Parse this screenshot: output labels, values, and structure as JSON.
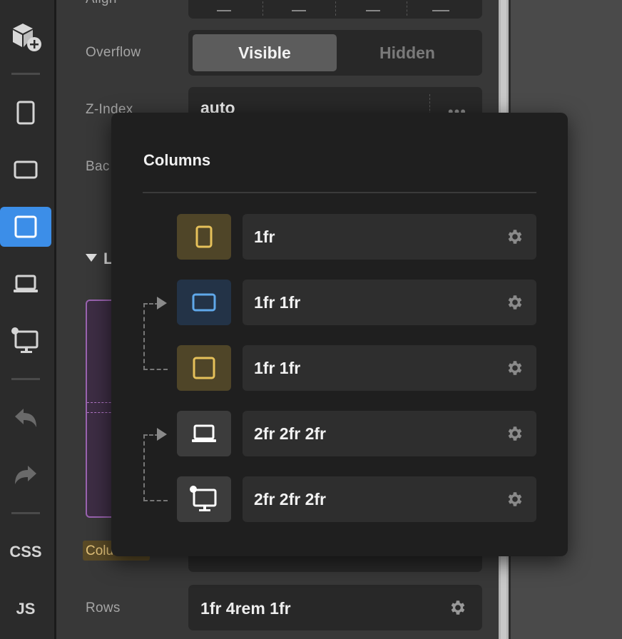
{
  "toolbar": {
    "css_label": "CSS",
    "js_label": "JS"
  },
  "panel": {
    "align_label": "Align",
    "overflow_label": "Overflow",
    "overflow_options": [
      "Visible",
      "Hidden"
    ],
    "overflow_selected": "Visible",
    "zindex_label": "Z-Index",
    "zindex_value": "auto",
    "background_label": "Bac",
    "layout_label": "L",
    "columns_label": "Colu",
    "rows_label": "Rows",
    "rows_value": "1fr 4rem 1fr"
  },
  "popup": {
    "title": "Columns",
    "breakpoints": [
      {
        "icon": "mobile-icon",
        "value": "1fr",
        "color": "#e6c15a",
        "bg": "#4f4528"
      },
      {
        "icon": "tablet-landscape-icon",
        "value": "1fr 1fr",
        "color": "#5fa8ea",
        "bg": "#233347"
      },
      {
        "icon": "tablet-portrait-icon",
        "value": "1fr 1fr",
        "color": "#e6c15a",
        "bg": "#4f4528"
      },
      {
        "icon": "laptop-icon",
        "value": "2fr 2fr 2fr",
        "color": "#ffffff",
        "bg": "#3c3c3c"
      },
      {
        "icon": "desktop-icon",
        "value": "2fr 2fr 2fr",
        "color": "#ffffff",
        "bg": "#3c3c3c"
      }
    ]
  },
  "colors": {
    "accent": "#3c8ee8",
    "popup_bg": "#1f1f1f"
  }
}
